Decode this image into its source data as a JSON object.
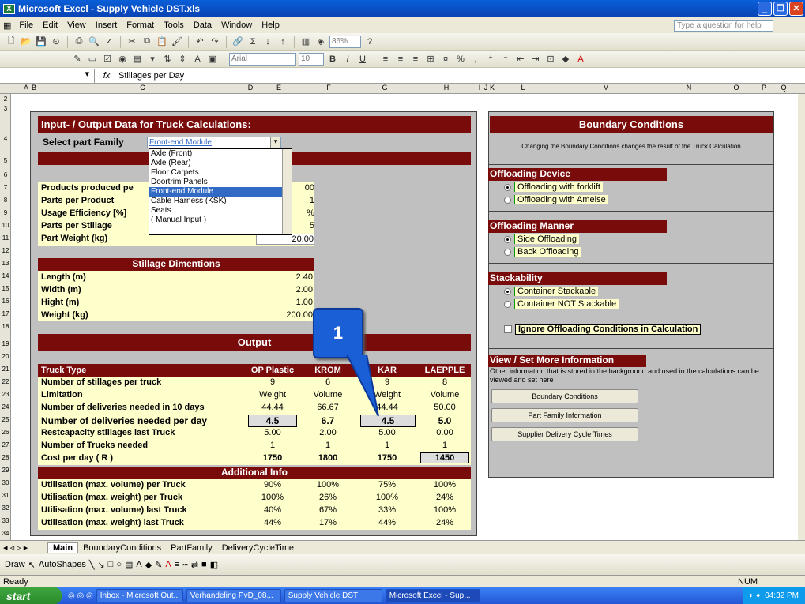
{
  "window": {
    "title": "Microsoft Excel - Supply Vehicle DST.xls",
    "help_placeholder": "Type a question for help"
  },
  "menu": [
    "File",
    "Edit",
    "View",
    "Insert",
    "Format",
    "Tools",
    "Data",
    "Window",
    "Help"
  ],
  "toolbar": {
    "zoom": "86%",
    "font": "Arial",
    "font_size": "10"
  },
  "formula": {
    "content": "Stillages per Day"
  },
  "columns": [
    "A",
    "B",
    "C",
    "D",
    "E",
    "F",
    "G",
    "H",
    "I",
    "J",
    "K",
    "L",
    "M",
    "N",
    "O",
    "P",
    "Q"
  ],
  "input": {
    "title": "Input- / Output Data for Truck Calculations:",
    "select_label": "Select part Family",
    "selected": "Front-end Module",
    "options": [
      "Axle (Front)",
      "Axle (Rear)",
      "Floor Carpets",
      "Doortrim Panels",
      "Front-end Module",
      "Cable Harness (KSK)",
      "Seats",
      "( Manual Input )"
    ],
    "params": [
      {
        "label": "Products produced pe",
        "value": "00"
      },
      {
        "label": "Parts per Product",
        "value": "1"
      },
      {
        "label": "Usage Efficiency [%]",
        "value": "%"
      },
      {
        "label": "Parts per Stillage",
        "value": "5"
      },
      {
        "label": "Part Weight (kg)",
        "value": "20.00"
      }
    ],
    "stillage_title": "Stillage Dimentions",
    "stillage": [
      {
        "label": "Length (m)",
        "value": "2.40"
      },
      {
        "label": "Width (m)",
        "value": "2.00"
      },
      {
        "label": "Hight (m)",
        "value": "1.00"
      },
      {
        "label": "Weight (kg)",
        "value": "200.00"
      }
    ]
  },
  "output": {
    "title": "Output",
    "header_label": "Truck Type",
    "trucks": [
      "OP Plastic",
      "KROM",
      "KAR",
      "LAEPPLE"
    ],
    "rows": [
      {
        "label": "Number of stillages per truck",
        "values": [
          "9",
          "6",
          "9",
          "8"
        ]
      },
      {
        "label": "Limitation",
        "values": [
          "Weight",
          "Volume",
          "Weight",
          "Volume"
        ]
      },
      {
        "label": "Number of deliveries needed in 10 days",
        "values": [
          "44.44",
          "66.67",
          "44.44",
          "50.00"
        ]
      },
      {
        "label": "Number of deliveries needed per day",
        "values": [
          "4.5",
          "6.7",
          "4.5",
          "5.0"
        ]
      },
      {
        "label": "Restcapacity stillages last Truck",
        "values": [
          "5.00",
          "2.00",
          "5.00",
          "0.00"
        ]
      },
      {
        "label": "Number of Trucks needed",
        "values": [
          "1",
          "1",
          "1",
          "1"
        ]
      },
      {
        "label": "Cost per day ( R )",
        "values": [
          "1750",
          "1800",
          "1750",
          "1450"
        ]
      }
    ],
    "additional_title": "Additional Info",
    "additional": [
      {
        "label": "Utilisation (max. volume) per Truck",
        "values": [
          "90%",
          "100%",
          "75%",
          "100%"
        ]
      },
      {
        "label": "Utilisation (max. weight) per Truck",
        "values": [
          "100%",
          "26%",
          "100%",
          "24%"
        ]
      },
      {
        "label": "Utilisation (max. volume) last Truck",
        "values": [
          "40%",
          "67%",
          "33%",
          "100%"
        ]
      },
      {
        "label": "Utilisation (max. weight) last Truck",
        "values": [
          "44%",
          "17%",
          "44%",
          "24%"
        ]
      }
    ]
  },
  "boundary": {
    "title": "Boundary Conditions",
    "note": "Changing the Boundary Conditions changes the result of the Truck Calculation",
    "device_title": "Offloading Device",
    "device_opts": [
      "Offloading with forklift",
      "Offloading with Ameise"
    ],
    "manner_title": "Offloading Manner",
    "manner_opts": [
      "Side Offloading",
      "Back Offloading"
    ],
    "stack_title": "Stackability",
    "stack_opts": [
      "Container Stackable",
      "Container NOT Stackable"
    ],
    "ignore_label": "Ignore Offloading Conditions in Calculation",
    "more_title": "View / Set More Information",
    "more_note": "Other information that is stored in the background and used in the calculations can be viewed and set here",
    "buttons": [
      "Boundary Conditions",
      "Part Family Information",
      "Supplier Delivery Cycle Times"
    ]
  },
  "callout": "1",
  "tabs": [
    "Main",
    "BoundaryConditions",
    "PartFamily",
    "DeliveryCycleTime"
  ],
  "drawbar": {
    "draw": "Draw",
    "autoshapes": "AutoShapes"
  },
  "status": {
    "left": "Ready",
    "num": "NUM"
  },
  "taskbar": {
    "start": "start",
    "tasks": [
      "Inbox - Microsoft Out...",
      "Verhandeling PvD_08...",
      "Supply Vehicle DST",
      "Microsoft Excel - Sup..."
    ],
    "time": "04:32 PM"
  }
}
